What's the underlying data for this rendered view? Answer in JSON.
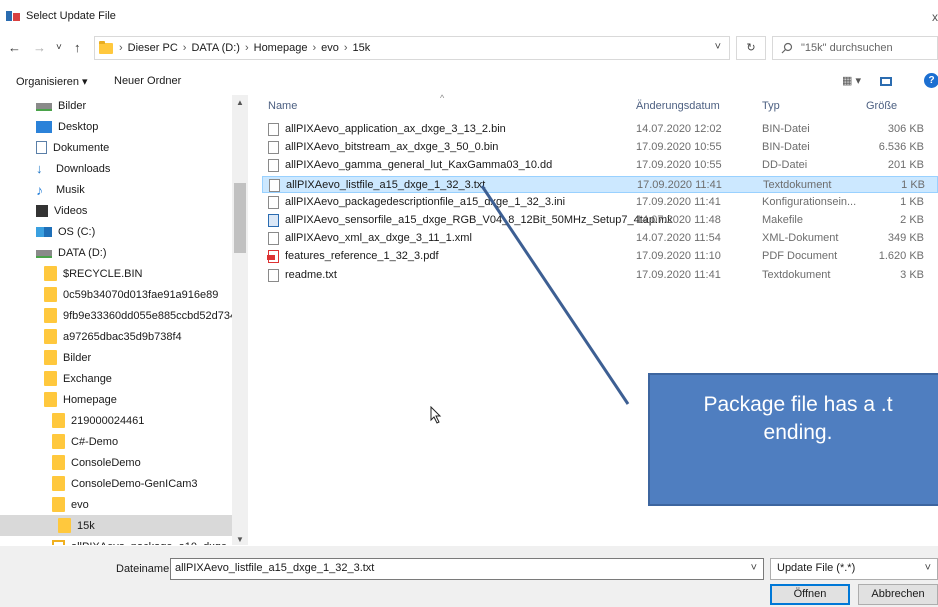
{
  "window": {
    "title": "Select Update File",
    "close_glyph": "x"
  },
  "nav": {
    "back": "←",
    "forward": "→",
    "recent": "˅",
    "up": "↑",
    "refresh": "↻"
  },
  "address": {
    "crumbs": [
      "Dieser PC",
      "DATA (D:)",
      "Homepage",
      "evo",
      "15k"
    ],
    "separator": "›"
  },
  "search": {
    "placeholder": "\"15k\" durchsuchen",
    "icon": "search-icon"
  },
  "toolbar": {
    "organize": "Organisieren ▾",
    "new_folder": "Neuer Ordner",
    "view_options": "▦ ▾",
    "help": "?"
  },
  "sidebar": {
    "items": [
      {
        "label": "Bilder",
        "icon": "pictures-icon"
      },
      {
        "label": "Desktop",
        "icon": "desktop-icon"
      },
      {
        "label": "Dokumente",
        "icon": "documents-icon"
      },
      {
        "label": "Downloads",
        "icon": "downloads-icon"
      },
      {
        "label": "Musik",
        "icon": "music-icon"
      },
      {
        "label": "Videos",
        "icon": "videos-icon"
      },
      {
        "label": "OS (C:)",
        "icon": "os-drive-icon"
      },
      {
        "label": "DATA (D:)",
        "icon": "drive-icon"
      },
      {
        "label": "$RECYCLE.BIN",
        "icon": "folder-icon"
      },
      {
        "label": "0c59b34070d013fae91a916e89",
        "icon": "folder-icon"
      },
      {
        "label": "9fb9e33360dd055e885ccbd52d73486e",
        "icon": "folder-icon"
      },
      {
        "label": "a97265dbac35d9b738f4",
        "icon": "folder-icon"
      },
      {
        "label": "Bilder",
        "icon": "folder-icon"
      },
      {
        "label": "Exchange",
        "icon": "folder-icon"
      },
      {
        "label": "Homepage",
        "icon": "folder-icon"
      },
      {
        "label": "219000024461",
        "icon": "folder-icon"
      },
      {
        "label": "C#-Demo",
        "icon": "folder-icon"
      },
      {
        "label": "ConsoleDemo",
        "icon": "folder-icon"
      },
      {
        "label": "ConsoleDemo-GenICam3",
        "icon": "folder-icon"
      },
      {
        "label": "evo",
        "icon": "folder-icon"
      },
      {
        "label": "15k",
        "icon": "folder-icon",
        "selected": true
      },
      {
        "label": "allPIXAevo_package_a10_dxge_1_3",
        "icon": "package-icon"
      }
    ]
  },
  "columns": {
    "name": "Name",
    "date": "Änderungsdatum",
    "type": "Typ",
    "size": "Größe"
  },
  "files": [
    {
      "name": "allPIXAevo_application_ax_dxge_3_13_2.bin",
      "date": "14.07.2020 12:02",
      "type": "BIN-Datei",
      "size": "306 KB"
    },
    {
      "name": "allPIXAevo_bitstream_ax_dxge_3_50_0.bin",
      "date": "17.09.2020 10:55",
      "type": "BIN-Datei",
      "size": "6.536 KB"
    },
    {
      "name": "allPIXAevo_gamma_general_lut_KaxGamma03_10.dd",
      "date": "17.09.2020 10:55",
      "type": "DD-Datei",
      "size": "201 KB"
    },
    {
      "name": "allPIXAevo_listfile_a15_dxge_1_32_3.txt",
      "date": "17.09.2020 11:41",
      "type": "Textdokument",
      "size": "1 KB",
      "highlighted": true
    },
    {
      "name": "allPIXAevo_packagedescriptionfile_a15_dxge_1_32_3.ini",
      "date": "17.09.2020 11:41",
      "type": "Konfigurationsein...",
      "size": "1 KB"
    },
    {
      "name": "allPIXAevo_sensorfile_a15_dxge_RGB_V04_8_12Bit_50MHz_Setup7_4tap.mk",
      "date": "14.07.2020 11:48",
      "type": "Makefile",
      "size": "2 KB"
    },
    {
      "name": "allPIXAevo_xml_ax_dxge_3_11_1.xml",
      "date": "14.07.2020 11:54",
      "type": "XML-Dokument",
      "size": "349 KB"
    },
    {
      "name": "features_reference_1_32_3.pdf",
      "date": "17.09.2020 11:10",
      "type": "PDF Document",
      "size": "1.620 KB"
    },
    {
      "name": "readme.txt",
      "date": "17.09.2020 11:41",
      "type": "Textdokument",
      "size": "3 KB"
    }
  ],
  "footer": {
    "filename_label": "Dateiname:",
    "filename_value": "allPIXAevo_listfile_a15_dxge_1_32_3.txt",
    "filetype_value": "Update File (*.*)",
    "open": "Öffnen",
    "cancel": "Abbrechen"
  },
  "callout": {
    "line1": "Package file has a .t",
    "line2": "ending."
  },
  "colors": {
    "accent": "#0078d7",
    "selection": "#cce8ff",
    "callout": "#4f7ec0"
  }
}
